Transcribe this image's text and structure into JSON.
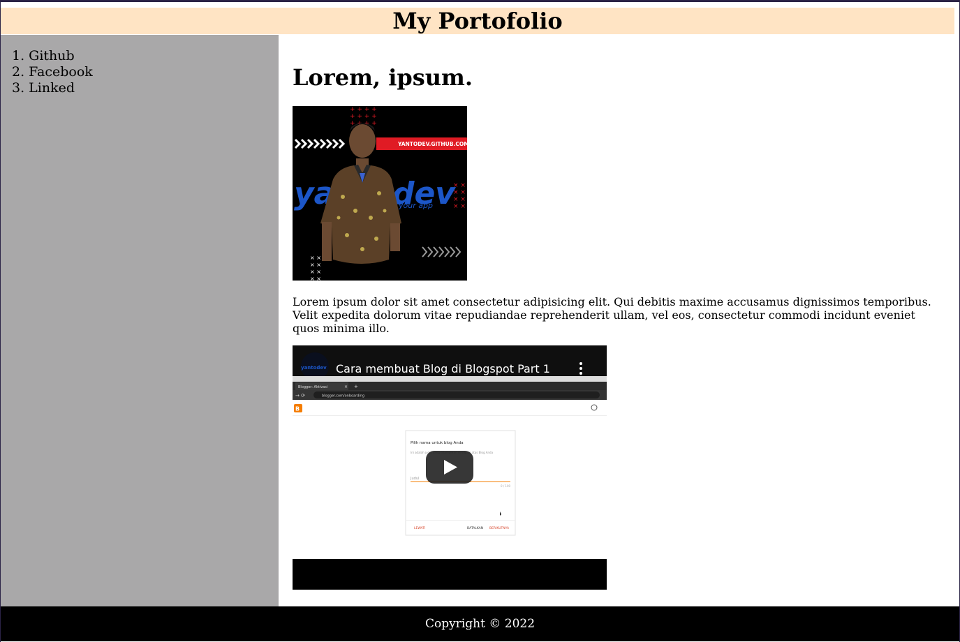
{
  "header": {
    "title": "My Portofolio"
  },
  "sidebar": {
    "items": [
      {
        "num": "1.",
        "label": "Github"
      },
      {
        "num": "2.",
        "label": "Facebook"
      },
      {
        "num": "3.",
        "label": "Linked"
      }
    ]
  },
  "main": {
    "heading": "Lorem, ipsum.",
    "photo": {
      "banner_text": "YANTODEV.GITHUB.COM",
      "brand_text": "yantodev",
      "tagline": "your app"
    },
    "paragraph": "Lorem ipsum dolor sit amet consectetur adipisicing elit. Qui debitis maxime accusamus dignissimos temporibus. Velit expedita dolorum vitae repudiandae reprehenderit ullam, vel eos, consectetur commodi incidunt eveniet quos minima illo.",
    "video": {
      "title": "Cara membuat Blog di Blogspot Part 1",
      "channel_label": "yantodev",
      "browser_tab": "Blogger: Aktivasi",
      "browser_url": "blogger.com/onboarding",
      "dialog_title": "Pilih nama untuk blog Anda",
      "dialog_desc": "Ini adalah judul yang ditampilkan di bagian atas Blog Anda",
      "dialog_field": "Judul",
      "dialog_counter": "0 / 100",
      "dialog_skip": "LEWATI",
      "dialog_cancel": "BATALKAN",
      "dialog_next": "BERIKUTNYA"
    }
  },
  "footer": {
    "copyright": "Copyright © 2022"
  },
  "colors": {
    "header_bg": "#ffe4c4",
    "sidebar_bg": "#a9a8a9",
    "footer_bg": "#000000"
  }
}
